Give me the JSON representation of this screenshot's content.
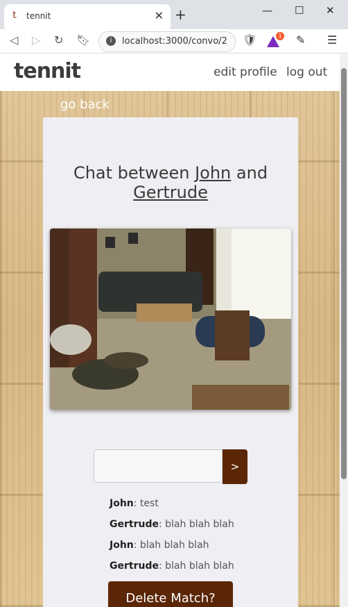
{
  "browser": {
    "tab_title": "tennit",
    "favicon_letter": "t",
    "url": "localhost:3000/convo/2",
    "extension_badge": "1"
  },
  "nav": {
    "brand": "tennit",
    "edit_profile": "edit profile",
    "log_out": "log out",
    "go_back": "go back"
  },
  "chat": {
    "title_prefix": "Chat between",
    "user1": "John",
    "and": "and",
    "user2": "Gertrude",
    "send_label": ">",
    "input_value": "",
    "messages": [
      {
        "author": "John",
        "text": ": test"
      },
      {
        "author": "Gertrude",
        "text": ": blah blah blah"
      },
      {
        "author": "John",
        "text": ": blah blah blah"
      },
      {
        "author": "Gertrude",
        "text": ": blah blah blah"
      }
    ],
    "delete_label": "Delete Match?"
  },
  "colors": {
    "accent": "#5a2606",
    "card": "#efeef2"
  }
}
